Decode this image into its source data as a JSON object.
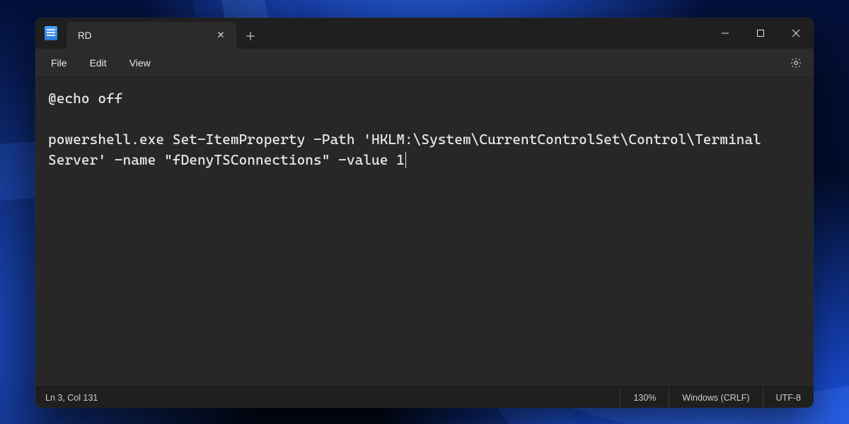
{
  "tab": {
    "title": "RD",
    "close_tooltip": "Close tab"
  },
  "menubar": {
    "file": "File",
    "edit": "Edit",
    "view": "View"
  },
  "editor": {
    "content": "@echo off\n\npowershell.exe Set-ItemProperty -Path 'HKLM:\\System\\CurrentControlSet\\Control\\Terminal Server' -name \"fDenyTSConnections\" -value 1"
  },
  "statusbar": {
    "position": "Ln 3, Col 131",
    "zoom": "130%",
    "line_ending": "Windows (CRLF)",
    "encoding": "UTF-8"
  },
  "icons": {
    "plus": "＋",
    "x": "✕"
  }
}
